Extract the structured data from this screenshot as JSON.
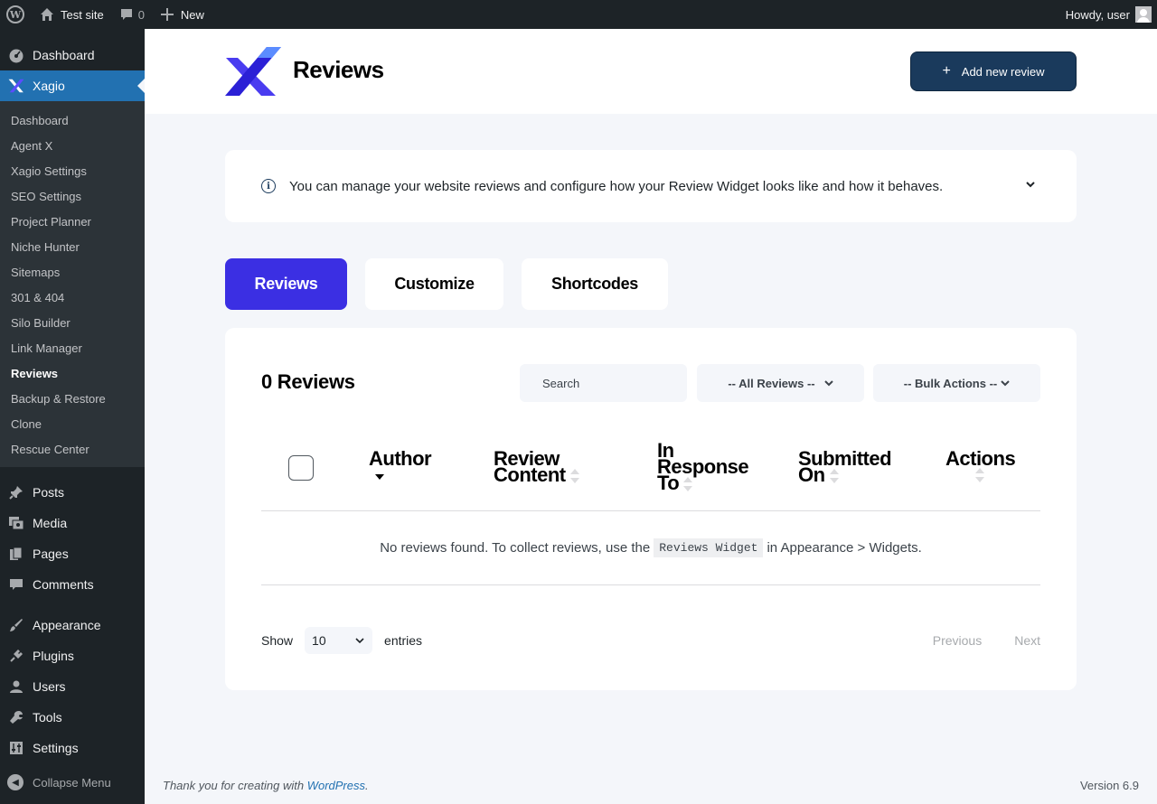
{
  "adminbar": {
    "site_name": "Test site",
    "comments_count": "0",
    "new_label": "New",
    "howdy": "Howdy, user"
  },
  "sidebar": {
    "dashboard": "Dashboard",
    "xagio": "Xagio",
    "submenu": [
      "Dashboard",
      "Agent X",
      "Xagio Settings",
      "SEO Settings",
      "Project Planner",
      "Niche Hunter",
      "Sitemaps",
      "301 & 404",
      "Silo Builder",
      "Link Manager",
      "Reviews",
      "Backup & Restore",
      "Clone",
      "Rescue Center"
    ],
    "posts": "Posts",
    "media": "Media",
    "pages": "Pages",
    "comments": "Comments",
    "appearance": "Appearance",
    "plugins": "Plugins",
    "users": "Users",
    "tools": "Tools",
    "settings": "Settings",
    "collapse": "Collapse Menu"
  },
  "header": {
    "title": "Reviews",
    "add_button": "Add new review"
  },
  "info": {
    "text": "You can manage your website reviews and configure how your Review Widget looks like and how it behaves."
  },
  "tabs": [
    "Reviews",
    "Customize",
    "Shortcodes"
  ],
  "panel": {
    "count_title": "0 Reviews",
    "search_placeholder": "Search",
    "filter_select": "-- All Reviews --",
    "bulk_select": "-- Bulk Actions --",
    "columns": {
      "author": "Author",
      "content": [
        "Review",
        "Content"
      ],
      "response": [
        "In",
        "Response",
        "To"
      ],
      "submitted": [
        "Submitted",
        "On"
      ],
      "actions": "Actions"
    },
    "empty_before": "No reviews found. To collect reviews, use the",
    "empty_code": "Reviews Widget",
    "empty_after": "in Appearance > Widgets.",
    "show_label": "Show",
    "page_length": "10",
    "entries_label": "entries",
    "previous": "Previous",
    "next": "Next"
  },
  "footer": {
    "thanks": "Thank you for creating with",
    "wp_link": "WordPress",
    "version": "Version 6.9"
  },
  "colors": {
    "accent": "#3b2fe3",
    "button_dark": "#1a3a5c",
    "wp_blue": "#2271b1",
    "admin_dark": "#1d2327"
  }
}
